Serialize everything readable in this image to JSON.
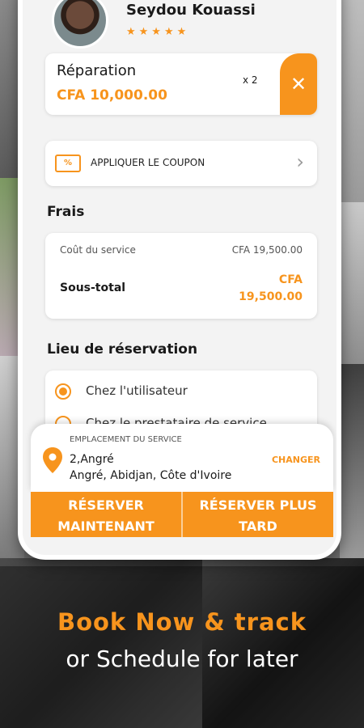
{
  "provider": {
    "name": "Seydou Kouassi",
    "stars": "★★★★★"
  },
  "service": {
    "name": "Réparation",
    "price": "CFA 10,000.00",
    "quantity": "x 2",
    "remove_icon": "close-icon"
  },
  "coupon": {
    "icon": "coupon-icon",
    "icon_text": "%",
    "label": "APPLIQUER LE COUPON"
  },
  "fees": {
    "title": "Frais",
    "service_cost_label": "Coût du service",
    "service_cost_value": "CFA 19,500.00",
    "subtotal_label": "Sous-total",
    "subtotal_value": "CFA 19,500.00"
  },
  "booking_location": {
    "title": "Lieu de réservation",
    "options": [
      {
        "label": "Chez l'utilisateur",
        "selected": true
      },
      {
        "label": "Chez le prestataire de service",
        "selected": false
      }
    ]
  },
  "service_address": {
    "header": "EMPLACEMENT DU SERVICE",
    "line1": "2,Angré",
    "line2": "Angré, Abidjan, Côte d'Ivoire",
    "change_label": "CHANGER"
  },
  "actions": {
    "book_now": "RÉSERVER MAINTENANT",
    "book_later": "RÉSERVER PLUS TARD"
  },
  "slogan": {
    "line1": "Book Now & track",
    "line2": "or Schedule for later"
  },
  "colors": {
    "accent": "#f7941d",
    "text": "#1a1a1a"
  }
}
